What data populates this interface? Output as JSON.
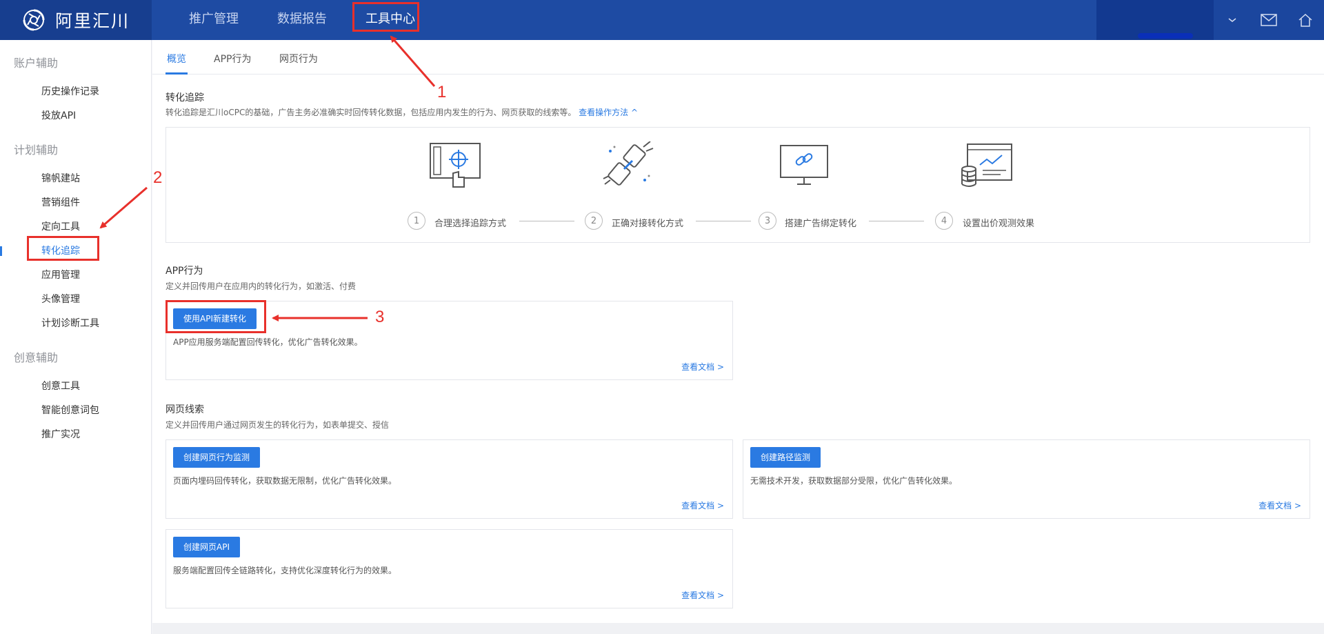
{
  "app": {
    "logo_text": "阿里汇川"
  },
  "top_nav": {
    "items": [
      {
        "label": "推广管理"
      },
      {
        "label": "数据报告"
      },
      {
        "label": "工具中心",
        "active": true
      }
    ]
  },
  "top_icons": [
    "chevron-down-icon",
    "mail-icon",
    "home-icon"
  ],
  "sidebar": {
    "groups": [
      {
        "title": "账户辅助",
        "items": [
          "历史操作记录",
          "投放API"
        ]
      },
      {
        "title": "计划辅助",
        "items": [
          "锦帆建站",
          "营销组件",
          "定向工具",
          "转化追踪",
          "应用管理",
          "头像管理",
          "计划诊断工具"
        ]
      },
      {
        "title": "创意辅助",
        "items": [
          "创意工具",
          "智能创意词包",
          "推广实况"
        ]
      }
    ],
    "active_item": "转化追踪"
  },
  "tabs": {
    "overview": "概览",
    "app": "APP行为",
    "web": "网页行为",
    "active": "概览"
  },
  "tracking": {
    "title": "转化追踪",
    "desc": "转化追踪是汇川oCPC的基础，广告主务必准确实时回传转化数据，包括应用内发生的行为、网页获取的线索等。",
    "link": "查看操作方法 ^",
    "steps": [
      {
        "num": "1",
        "label": "合理选择追踪方式",
        "icon": "screen-target-icon"
      },
      {
        "num": "2",
        "label": "正确对接转化方式",
        "icon": "plug-connect-icon"
      },
      {
        "num": "3",
        "label": "搭建广告绑定转化",
        "icon": "monitor-link-icon"
      },
      {
        "num": "4",
        "label": "设置出价观测效果",
        "icon": "chart-database-icon"
      }
    ]
  },
  "app_section": {
    "title": "APP行为",
    "desc": "定义并回传用户在应用内的转化行为，如激活、付费",
    "card": {
      "button": "使用API新建转化",
      "desc": "APP应用服务端配置回传转化，优化广告转化效果。",
      "link": "查看文档 >"
    }
  },
  "web_section": {
    "title": "网页线索",
    "desc": "定义并回传用户通过网页发生的转化行为，如表单提交、授信",
    "cards": [
      {
        "button": "创建网页行为监测",
        "desc": "页面内埋码回传转化，获取数据无限制，优化广告转化效果。",
        "link": "查看文档 >"
      },
      {
        "button": "创建路径监测",
        "desc": "无需技术开发，获取数据部分受限，优化广告转化效果。",
        "link": "查看文档 >"
      },
      {
        "button": "创建网页API",
        "desc": "服务端配置回传全链路转化，支持优化深度转化行为的效果。",
        "link": "查看文档 >"
      }
    ]
  },
  "annotations": {
    "one": "1",
    "two": "2",
    "three": "3",
    "color": "#e8302b"
  },
  "colors": {
    "topbar": "#1e4ba3",
    "accent": "#2a7ae2",
    "annotation": "#e8302b"
  }
}
